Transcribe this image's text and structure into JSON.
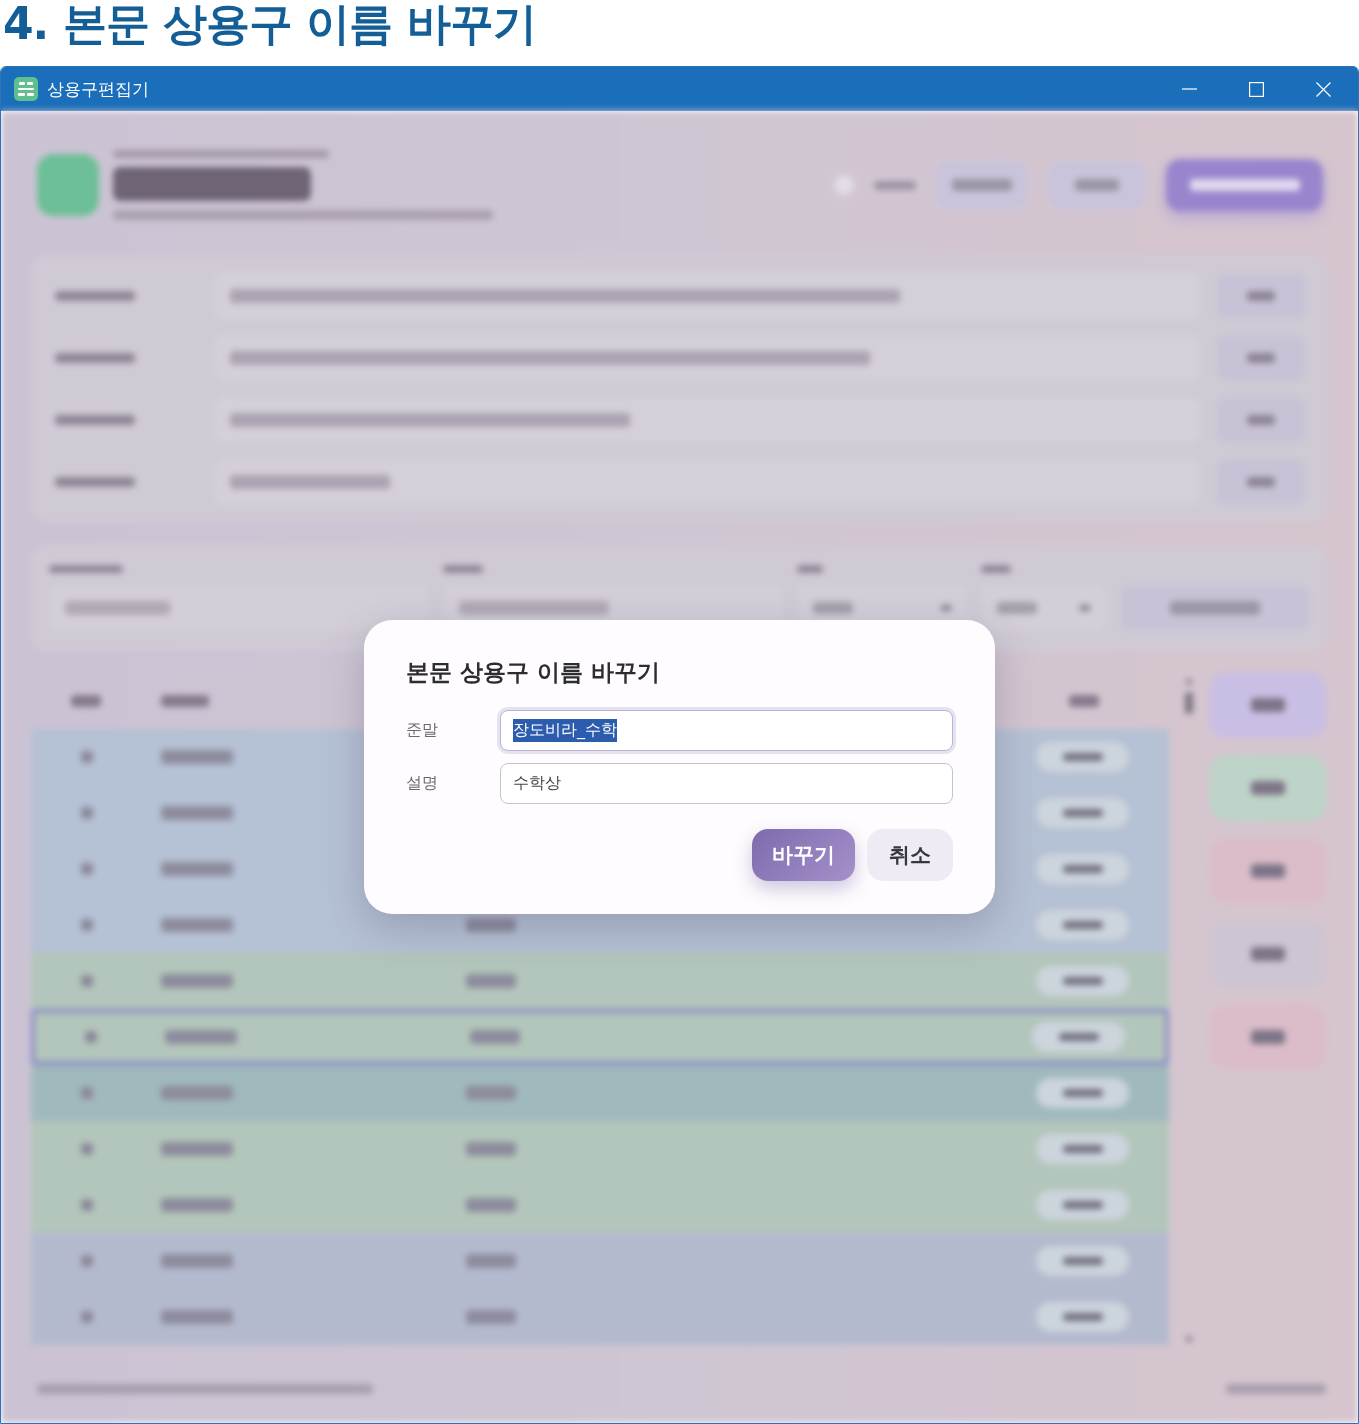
{
  "heading": "4. 본문 상용구 이름 바꾸기",
  "window": {
    "title": "상용구편집기"
  },
  "backdrop": {
    "rows": [
      {
        "color": "#b5c1d4",
        "selected": false
      },
      {
        "color": "#b5c1d4",
        "selected": false
      },
      {
        "color": "#b5c1d4",
        "selected": false
      },
      {
        "color": "#b5c1d4",
        "selected": false
      },
      {
        "color": "#b3c6bb",
        "selected": false
      },
      {
        "color": "#b3c6bb",
        "selected": true
      },
      {
        "color": "#a0b9bc",
        "selected": false
      },
      {
        "color": "#b3c6bb",
        "selected": false
      },
      {
        "color": "#b3c6bb",
        "selected": false
      },
      {
        "color": "#b4bace",
        "selected": false
      },
      {
        "color": "#b4bace",
        "selected": false
      }
    ],
    "side_buttons": [
      {
        "color": "#c9bfe4"
      },
      {
        "color": "#bed4c8"
      },
      {
        "color": "#dbbdc9"
      },
      {
        "color": "#cdc5d1"
      },
      {
        "color": "#dbbdc9"
      }
    ]
  },
  "dialog": {
    "title": "본문 상용구 이름 바꾸기",
    "fields": [
      {
        "label": "준말",
        "value": "장도비라_수학",
        "focused": true,
        "text_selected": true
      },
      {
        "label": "설명",
        "value": "수학상",
        "focused": false,
        "text_selected": false
      }
    ],
    "buttons": [
      {
        "label": "바꾸기",
        "kind": "primary"
      },
      {
        "label": "취소",
        "kind": "secondary"
      }
    ]
  }
}
